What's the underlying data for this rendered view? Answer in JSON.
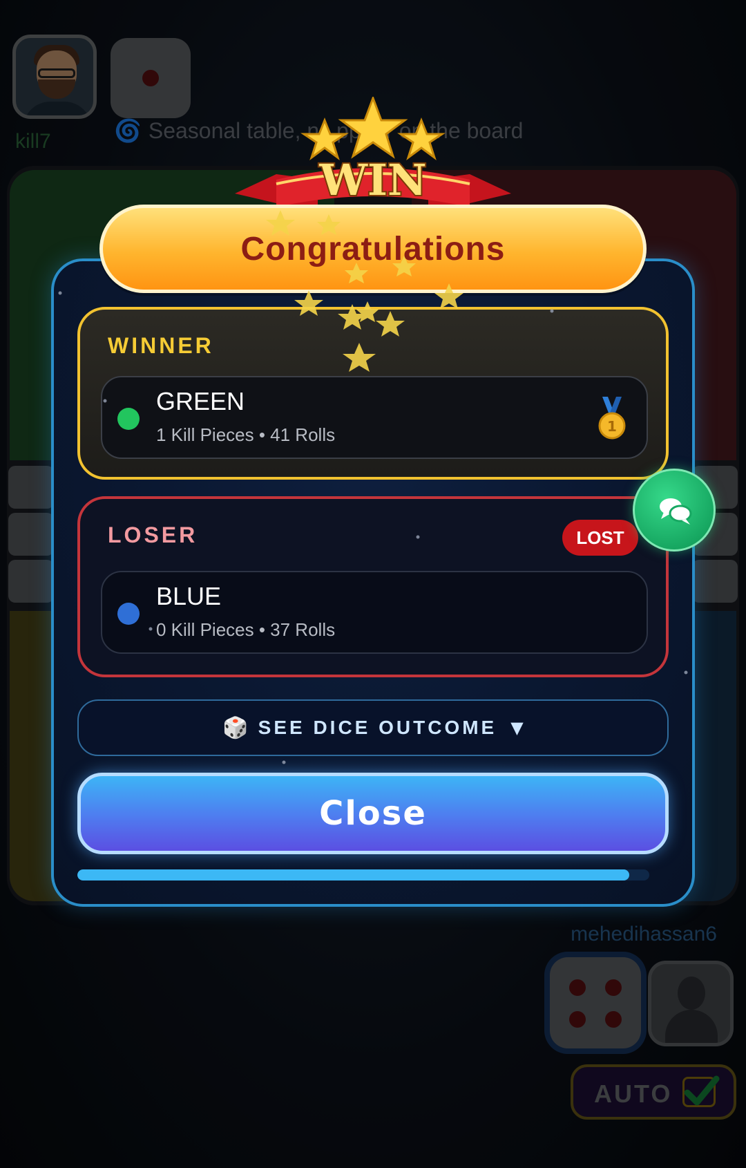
{
  "top_player": {
    "name": "kill7",
    "avatar_icon": "memoji-avatar",
    "dice_value": 1
  },
  "ticker": {
    "icon": "cyclone-icon",
    "text": "Seasonal table, [item]ns appear on the board",
    "text_visible": "Seasonal table,    ns   ppear on the board"
  },
  "bottom_player": {
    "name": "mehedihassan6",
    "dice_value": 4,
    "avatar_icon": "default-user-avatar"
  },
  "auto": {
    "label": "AUTO",
    "checked": true
  },
  "result_modal": {
    "win_badge": "WIN",
    "banner_title": "Congratulations",
    "winner": {
      "section_label": "WINNER",
      "color_name": "GREEN",
      "color_hex": "#22c55e",
      "stats": "1 Kill Pieces • 41 Rolls",
      "medal_icon": "first-place-medal-icon"
    },
    "loser": {
      "section_label": "LOSER",
      "badge": "LOST",
      "color_name": "BLUE",
      "color_hex": "#2f6fd6",
      "stats": "0 Kill Pieces • 37 Rolls"
    },
    "dice_outcome": {
      "icon": "🎲",
      "label": "SEE DICE OUTCOME",
      "caret": "▼"
    },
    "close_label": "Close",
    "progress_fraction": 0.965
  },
  "colors": {
    "winner_border": "#f2c230",
    "loser_border": "#c4353b",
    "modal_border": "#2a8ec9",
    "close_gradient_top": "#3db4f6",
    "close_gradient_bottom": "#5b4fe2",
    "chat_button": "#17a862"
  }
}
